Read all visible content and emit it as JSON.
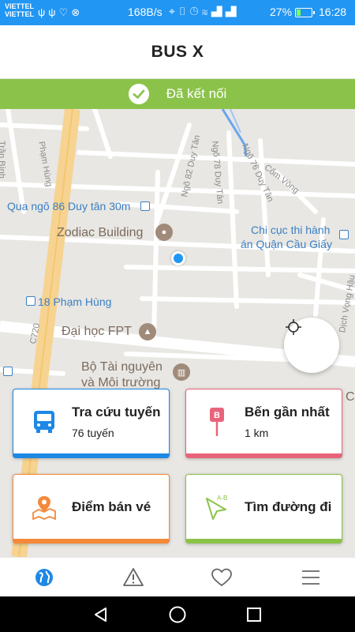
{
  "status_bar": {
    "carrier_1": "VIETTEL",
    "carrier_2": "VIETTEL",
    "left_icons": [
      "usb-icon",
      "usb-icon",
      "health-icon",
      "vpn-icon"
    ],
    "net_speed": "168B/s",
    "battery_pct": "27%",
    "battery_level": 0.27,
    "time": "16:28"
  },
  "app_bar": {
    "title": "BUS X"
  },
  "banner": {
    "text": "Đã kết nối",
    "color": "#8bc34a"
  },
  "map": {
    "labels": {
      "tran_binh": "Trần Bình",
      "pham_hung": "Phạm Hùng",
      "qua_ngo": "Qua ngõ 86 Duy tân 30m",
      "ngo82": "Ngõ 82 Duy Tân",
      "ngo78": "Ngõ 78 Duy Tân",
      "ngo76": "Ngõ 76 Duy Tân",
      "com_vong": "Cốm Vòng",
      "zodiac": "Zodiac Building",
      "chi_cuc_1": "Chi cục thi hành",
      "chi_cuc_2": "án Quận Cầu Giấy",
      "pham_hung_18": "18 Phạm Hùng",
      "dai_hoc_fpt": "Đại học FPT",
      "c720": "C720",
      "bo_tai_nguyen_1": "Bộ Tài nguyên",
      "bo_tai_nguyen_2": "và Môi trường",
      "dich_vong_hau": "Dịch Vọng Hậu",
      "edge_c": "C"
    }
  },
  "cards": {
    "route_lookup": {
      "title": "Tra cứu tuyến",
      "sub": "76 tuyến",
      "color": "#1e88e5",
      "icon": "bus-icon"
    },
    "nearest_stop": {
      "title": "Bến gần nhất",
      "sub": "1 km",
      "color": "#e8647a",
      "icon": "stop-marker-icon",
      "marker_letter": "B"
    },
    "ticket_points": {
      "title": "Điểm bán vé",
      "color": "#f5893a",
      "icon": "map-pin-icon"
    },
    "find_route": {
      "title": "Tìm đường đi",
      "color": "#8bc34a",
      "icon": "navigation-icon",
      "icon_label": "A-B"
    }
  },
  "bottom_nav": {
    "items": [
      {
        "name": "map",
        "icon": "globe-icon",
        "active": true
      },
      {
        "name": "alerts",
        "icon": "warning-icon",
        "active": false
      },
      {
        "name": "favorites",
        "icon": "heart-icon",
        "active": false
      },
      {
        "name": "menu",
        "icon": "menu-icon",
        "active": false
      }
    ]
  },
  "system_nav": {
    "icons": [
      "back-icon",
      "home-icon",
      "recents-icon"
    ]
  }
}
